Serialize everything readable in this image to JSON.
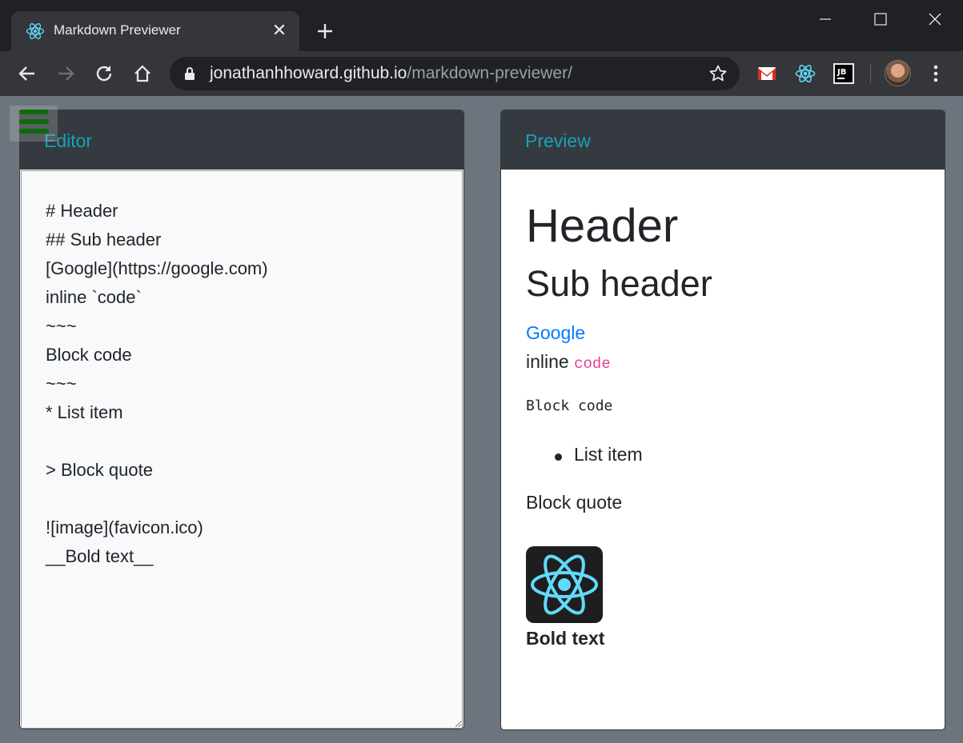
{
  "browser": {
    "tab_title": "Markdown Previewer",
    "url_host": "jonathanhhoward.github.io",
    "url_path": "/markdown-previewer/"
  },
  "editor": {
    "title": "Editor",
    "content": "# Header\n## Sub header\n[Google](https://google.com)\ninline `code`\n~~~\nBlock code\n~~~\n* List item\n\n> Block quote\n\n![image](favicon.ico)\n__Bold text__"
  },
  "preview": {
    "title": "Preview",
    "h1": "Header",
    "h2": "Sub header",
    "link_text": "Google",
    "inline_prefix": "inline ",
    "inline_code": "code",
    "block_code": "Block code",
    "list_item": "List item",
    "block_quote": "Block quote",
    "bold_text": "Bold text"
  },
  "colors": {
    "page_bg": "#6c757d",
    "card_header": "#343a40",
    "title_accent": "#17a2b8",
    "link": "#007bff",
    "inline_code": "#e83e8c",
    "hamburger": "#0b6b0b"
  },
  "icons": {
    "tab_favicon": "react-icon",
    "extensions": [
      "gmail-icon",
      "react-devtools-icon",
      "jetbrains-icon"
    ]
  }
}
